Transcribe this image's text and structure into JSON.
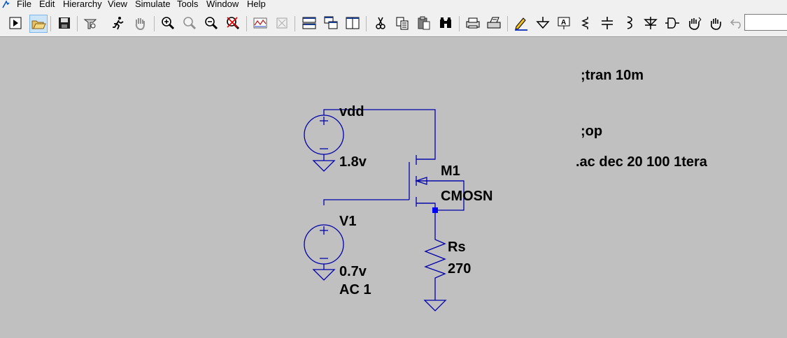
{
  "menu": [
    "File",
    "Edit",
    "Hierarchy",
    "View",
    "Simulate",
    "Tools",
    "Window",
    "Help"
  ],
  "toolbar": [
    "run-icon",
    "open-icon",
    "save-icon",
    "control-panel-icon",
    "halt-icon",
    "pan-hand-icon",
    "zoom-in-icon",
    "zoom-area-icon",
    "zoom-out-icon",
    "zoom-cancel-icon",
    "waveform-icon",
    "autorange-icon",
    "tile-horizontal-icon",
    "cascade-icon",
    "tile-vertical-icon",
    "cut-icon",
    "copy-icon",
    "paste-icon",
    "find-icon",
    "print-setup-icon",
    "print-icon",
    "draw-wire-icon",
    "ground-icon",
    "label-net-icon",
    "resistor-icon",
    "capacitor-icon",
    "inductor-icon",
    "diode-icon",
    "component-icon",
    "move-icon",
    "drag-icon",
    "undo-icon"
  ],
  "schematic": {
    "vdd_label": "vdd",
    "vdd_value": "1.8v",
    "m1_name": "M1",
    "m1_model": "CMOSN",
    "v1_name": "V1",
    "v1_value": "0.7v",
    "v1_ac": "AC 1",
    "rs_name": "Rs",
    "rs_value": "270",
    "directive_tran": ";tran 10m",
    "directive_op": ";op",
    "directive_ac": ".ac dec 20 100 1tera"
  },
  "colors": {
    "wire": "#0000aa",
    "junction": "#0000ff",
    "background": "#c0c0c0"
  }
}
